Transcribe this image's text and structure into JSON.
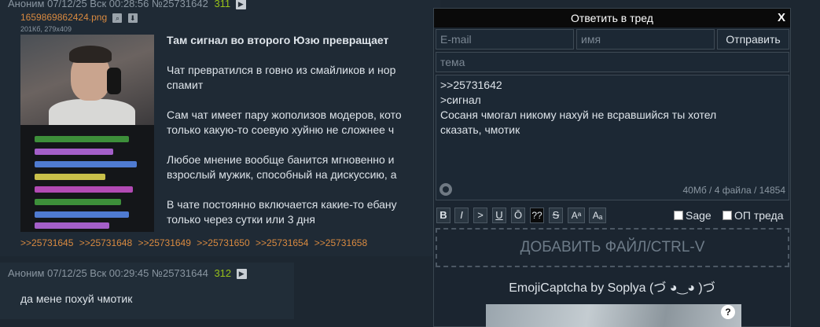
{
  "posts": [
    {
      "author": "Аноним",
      "datetime": "07/12/25 Вск 00:28:56",
      "number": "№25731642",
      "index": "311",
      "file": {
        "name": "1659869862424.png",
        "meta": "201Кб, 279x409"
      },
      "lines": [
        "Там сигнал во второго Юзю превращает",
        "Чат превратился в говно из смайликов и нор",
        "спамит",
        "Сам чат имеет пару жополизов модеров, кото",
        "только какую-то соевую хуйню не сложнее ч",
        "Любое мнение вообще банится мгновенно и",
        "взрослый мужик, способный на дискуссию, а",
        "В чате постоянно включается какие-то ебану",
        "только через сутки или 3 дня"
      ],
      "replies": [
        ">>25731645",
        ">>25731648",
        ">>25731649",
        ">>25731650",
        ">>25731654",
        ">>25731658"
      ]
    },
    {
      "author": "Аноним",
      "datetime": "07/12/25 Вск 00:29:45",
      "number": "№25731644",
      "index": "312",
      "text": "да мене похуй чмотик"
    }
  ],
  "reply_form": {
    "title": "Ответить в тред",
    "close": "X",
    "email_placeholder": "E-mail",
    "name_placeholder": "имя",
    "send_label": "Отправить",
    "subject_placeholder": "тема",
    "message_lines": [
      ">>25731642",
      ">сигнал",
      "Сосаня чмогал никому нахуй не всравшийся ты хотел",
      "сказать, чмотик"
    ],
    "counter": "40Мб / 4 файла / 14854",
    "toolbar": [
      "B",
      "I",
      ">",
      "U",
      "Ō",
      "??",
      "S",
      "Aᵃ",
      "Aₐ"
    ],
    "sage_label": "Sage",
    "op_label": "ОП треда",
    "dropzone_label": "ДОБАВИТЬ ФАЙЛ/CTRL-V",
    "captcha_title": "EmojiCaptcha by Soplya (づ ◕‿◕ )づ",
    "captcha_help": "?"
  },
  "colors": {
    "background": "#1d2731",
    "link": "#d98a40",
    "index_green": "#97c11a",
    "text": "#dde3e9"
  }
}
